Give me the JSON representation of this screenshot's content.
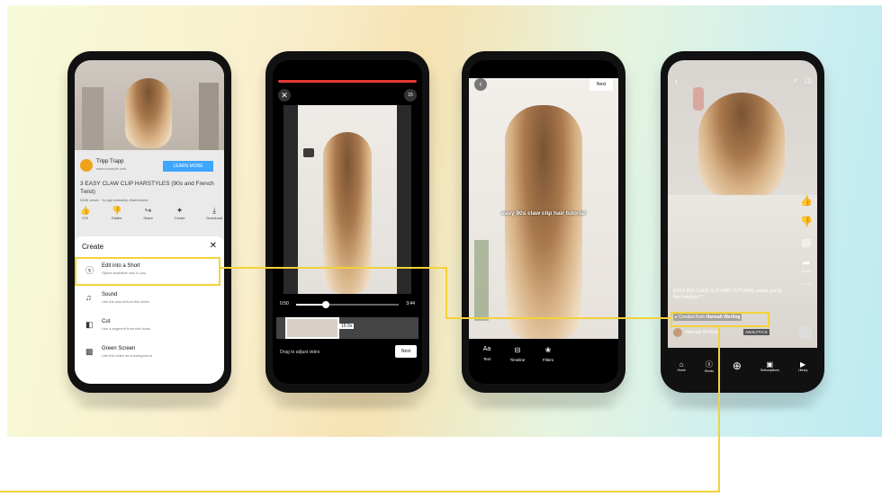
{
  "phone1": {
    "channel_name": "Tripp Trapp",
    "channel_sub": "www.example.com",
    "learn_more": "LEARN MORE",
    "video_title": "3 EASY CLAW CLIP HARSTYLES (90s and French Twist)",
    "video_meta": "548K views · 1y ago #clawclip #hairtutorial",
    "actions": [
      "27K",
      "Dislike",
      "Share",
      "Create",
      "Download"
    ],
    "sheet_title": "Create",
    "menu": [
      {
        "label": "Edit into a Short",
        "sub": "Option available only to you"
      },
      {
        "label": "Sound",
        "sub": "Use the sound from this video"
      },
      {
        "label": "Cut",
        "sub": "Use a segment from this video"
      },
      {
        "label": "Green Screen",
        "sub": "Use this video as a background"
      }
    ]
  },
  "phone2": {
    "counter": "15",
    "time_start": "0:50",
    "time_end": "3:44",
    "segment_label": "15.0s",
    "hint": "Drag to adjust video",
    "next": "Next"
  },
  "phone3": {
    "next": "Next",
    "caption": "easy 90s claw clip hair tutorial",
    "tools": [
      "Text",
      "Timeline",
      "Filters"
    ],
    "tool_icon_text": "Aa"
  },
  "phone4": {
    "side_counts": [
      "",
      "",
      "",
      "Share",
      "Remix"
    ],
    "caption": "EASY 90S CLAW CLIP HAIR TUTORIAL would you try this hairstyle??",
    "created_from_prefix": "Created from",
    "created_from_name": "Hannah Werling",
    "author": "Hannah Werling",
    "tag": "ANALYTICS",
    "nav": [
      "Home",
      "Shorts",
      "",
      "Subscriptions",
      "Library"
    ]
  },
  "colors": {
    "highlight": "#f3d23a",
    "accent_red": "#e53935",
    "cta_blue": "#3ea6ff"
  }
}
